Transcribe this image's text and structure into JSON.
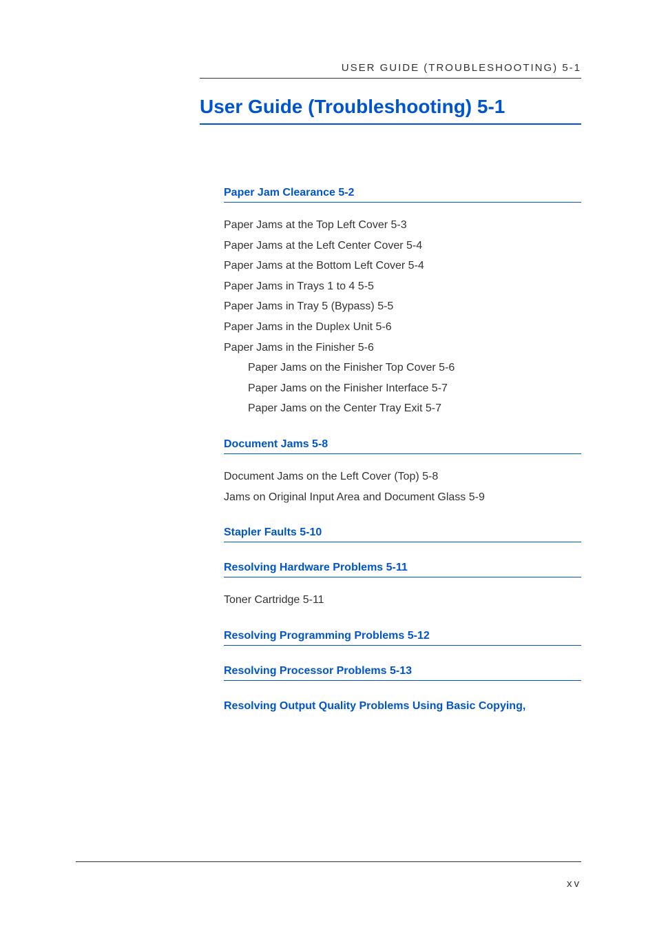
{
  "running_header": "USER GUIDE (TROUBLESHOOTING) 5-1",
  "main_title": "User Guide (Troubleshooting) 5-1",
  "sections": {
    "paper_jam": {
      "heading": "Paper Jam Clearance 5-2",
      "items": [
        "Paper Jams at the Top Left Cover 5-3",
        "Paper Jams at the Left Center Cover 5-4",
        "Paper Jams at the Bottom Left Cover 5-4",
        "Paper Jams in Trays 1 to 4 5-5",
        "Paper Jams in Tray 5 (Bypass) 5-5",
        "Paper Jams in the Duplex Unit 5-6",
        "Paper Jams in the Finisher 5-6"
      ],
      "subitems": [
        "Paper Jams on the Finisher Top Cover 5-6",
        "Paper Jams on the Finisher Interface 5-7",
        "Paper Jams on the Center Tray Exit 5-7"
      ]
    },
    "document_jams": {
      "heading": "Document Jams 5-8",
      "items": [
        "Document Jams on the Left Cover (Top) 5-8",
        "Jams on Original Input Area and Document Glass 5-9"
      ]
    },
    "stapler_faults": {
      "heading": "Stapler Faults 5-10"
    },
    "hardware": {
      "heading": "Resolving Hardware Problems 5-11",
      "items": [
        "Toner Cartridge 5-11"
      ]
    },
    "programming": {
      "heading": "Resolving Programming Problems 5-12"
    },
    "processor": {
      "heading": "Resolving Processor Problems 5-13"
    },
    "output_quality": {
      "heading": "Resolving Output Quality Problems Using Basic Copying,"
    }
  },
  "page_number": "xv"
}
